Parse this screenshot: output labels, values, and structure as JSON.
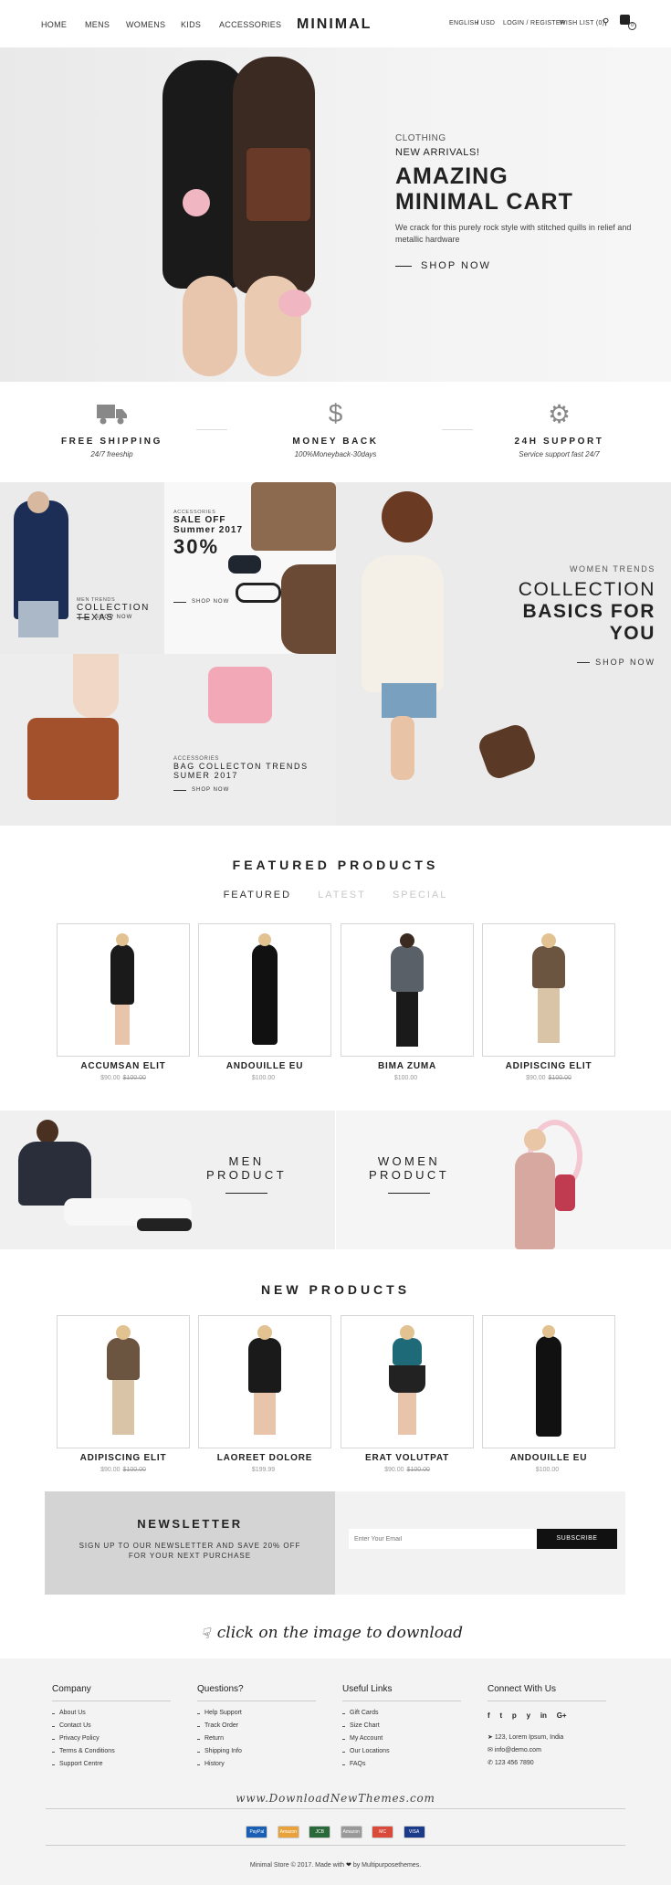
{
  "nav": {
    "left": [
      "HOME",
      "MENS",
      "WOMENS",
      "KIDS",
      "ACCESSORIES"
    ],
    "logo": "MINIMAL",
    "lang": "ENGLISH",
    "currency": "/ USD",
    "login": "LOGIN / REGISTER",
    "wishlist": "WISH LIST (0)",
    "cart_count": "0"
  },
  "hero": {
    "category": "CLOTHING",
    "tagline": "NEW ARRIVALS!",
    "title1": "AMAZING",
    "title2": "MINIMAL CART",
    "desc": "We crack for this purely rock style with stitched quills in relief and metallic hardware",
    "cta": "SHOP NOW"
  },
  "services": [
    {
      "title": "FREE SHIPPING",
      "sub": "24/7 freeship",
      "icon": "truck-icon"
    },
    {
      "title": "MONEY BACK",
      "sub": "100%Moneyback-30days",
      "icon": "dollar-icon"
    },
    {
      "title": "24H SUPPORT",
      "sub": "Service support fast 24/7",
      "icon": "gear-icon"
    }
  ],
  "collections": {
    "men": {
      "small": "MEN TRENDS",
      "line1": "COLLECTION",
      "line2": "TEXAS",
      "cta": "SHOP NOW"
    },
    "sale": {
      "small": "ACCESSORIES",
      "line1": "SALE OFF",
      "line2": "Summer 2017",
      "pct": "30%",
      "cta": "SHOP NOW"
    },
    "bag": {
      "small": "ACCESSORIES",
      "line1": "BAG COLLECTON TRENDS",
      "line2": "SUMER 2017",
      "cta": "SHOP NOW"
    },
    "women": {
      "small": "WOMEN TRENDS",
      "line1": "COLLECTION",
      "line2": "BASICS FOR",
      "line3": "YOU",
      "cta": "SHOP NOW"
    }
  },
  "featured": {
    "title": "FEATURED PRODUCTS",
    "tabs": [
      "FEATURED",
      "LATEST",
      "SPECIAL"
    ],
    "products": [
      {
        "name": "ACCUMSAN ELIT",
        "price": "$90.00",
        "old": "$100.00"
      },
      {
        "name": "ANDOUILLE EU",
        "price": "$100.00",
        "old": ""
      },
      {
        "name": "BIMA ZUMA",
        "price": "$100.00",
        "old": ""
      },
      {
        "name": "ADIPISCING ELIT",
        "price": "$90.00",
        "old": "$100.00"
      }
    ]
  },
  "banners": {
    "men": {
      "l1": "MEN",
      "l2": "PRODUCT"
    },
    "women": {
      "l1": "WOMEN",
      "l2": "PRODUCT"
    }
  },
  "new_products": {
    "title": "NEW PRODUCTS",
    "products": [
      {
        "name": "ADIPISCING ELIT",
        "price": "$90.00",
        "old": "$100.00"
      },
      {
        "name": "LAOREET DOLORE",
        "price": "$199.99",
        "old": ""
      },
      {
        "name": "ERAT VOLUTPAT",
        "price": "$90.00",
        "old": "$100.00"
      },
      {
        "name": "ANDOUILLE EU",
        "price": "$100.00",
        "old": ""
      }
    ]
  },
  "newsletter": {
    "title": "NEWSLETTER",
    "line1": "SIGN UP TO OUR NEWSLETTER AND SAVE 20% OFF",
    "line2": "FOR YOUR NEXT PURCHASE",
    "placeholder": "Enter Your Email",
    "button": "SUBSCRIBE"
  },
  "download_cta": "click on the image to download",
  "footer": {
    "company": {
      "title": "Company",
      "items": [
        "About Us",
        "Contact Us",
        "Privacy Policy",
        "Terms & Conditions",
        "Support Centre"
      ]
    },
    "questions": {
      "title": "Questions?",
      "items": [
        "Help Support",
        "Track Order",
        "Return",
        "Shipping Info",
        "History"
      ]
    },
    "links": {
      "title": "Useful Links",
      "items": [
        "Gift Cards",
        "Size Chart",
        "My Account",
        "Our Locations",
        "FAQs"
      ]
    },
    "connect": {
      "title": "Connect With Us",
      "social": [
        "f",
        "t",
        "p",
        "y",
        "in",
        "G+"
      ],
      "address": "123, Lorem Ipsum, India",
      "email": "info@demo.com",
      "phone": "123 456 7890"
    },
    "watermark": "www.DownloadNewThemes.com",
    "payments": [
      "PayPal",
      "Amazon",
      "JCB",
      "Amazon",
      "MC",
      "VISA"
    ],
    "copyright_pre": "Minimal Store © 2017. Made with",
    "copyright_post": "by Multipurposethemes."
  }
}
